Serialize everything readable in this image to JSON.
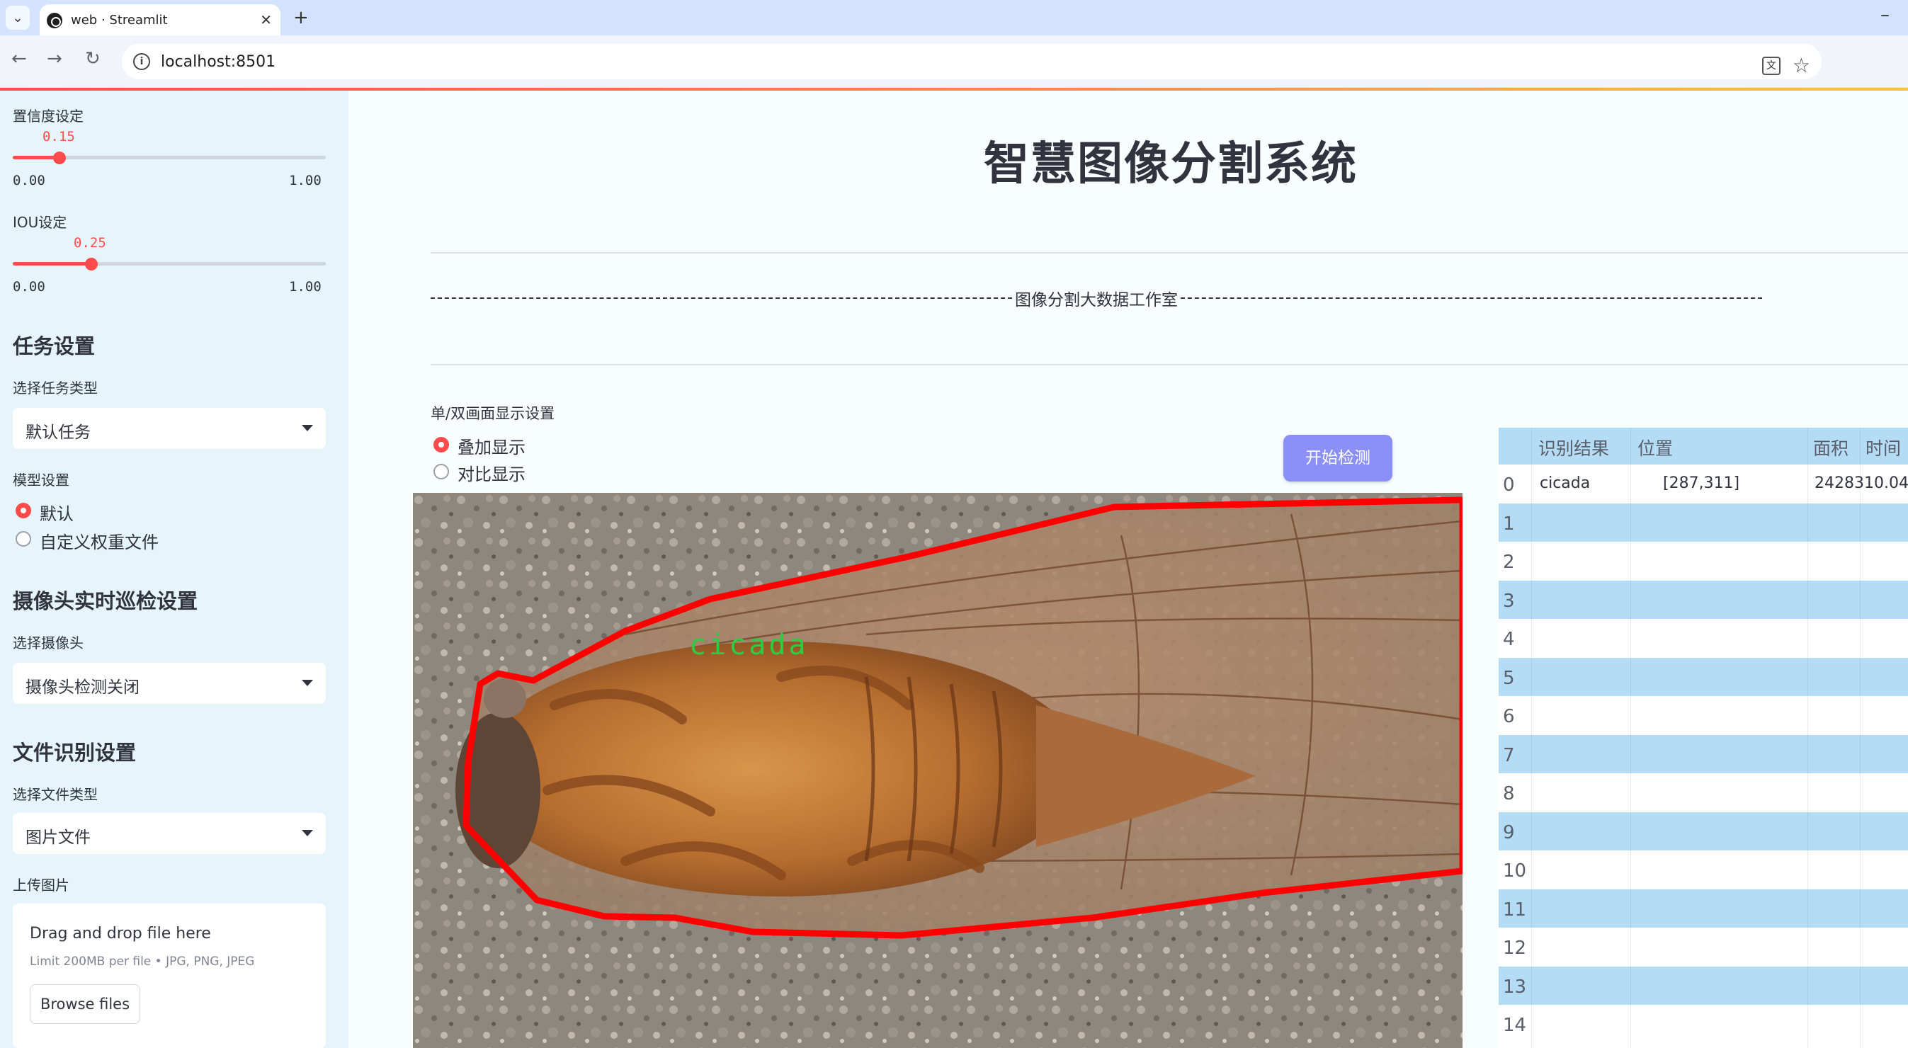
{
  "browser": {
    "tab_title": "web · Streamlit",
    "url": "localhost:8501"
  },
  "sidebar": {
    "confidence": {
      "label": "置信度设定",
      "value": "0.15",
      "min": "0.00",
      "max": "1.00",
      "fraction": 0.15
    },
    "iou": {
      "label": "IOU设定",
      "value": "0.25",
      "min": "0.00",
      "max": "1.00",
      "fraction": 0.25
    },
    "task_header": "任务设置",
    "task_type_label": "选择任务类型",
    "task_type_value": "默认任务",
    "model_label": "模型设置",
    "model_options": [
      "默认",
      "自定义权重文件"
    ],
    "camera_header": "摄像头实时巡检设置",
    "camera_label": "选择摄像头",
    "camera_value": "摄像头检测关闭",
    "file_header": "文件识别设置",
    "file_type_label": "选择文件类型",
    "file_type_value": "图片文件",
    "upload_label": "上传图片",
    "upload_title": "Drag and drop file here",
    "upload_limit": "Limit 200MB per file • JPG, PNG, JPEG",
    "browse_label": "Browse files"
  },
  "main": {
    "title": "智慧图像分割系统",
    "divider_text": "图像分割大数据工作室",
    "display_label": "单/双画面显示设置",
    "display_options": [
      "叠加显示",
      "对比显示"
    ],
    "detect_button": "开始检测",
    "detection_label": "cicada"
  },
  "results": {
    "columns": [
      "识别结果",
      "位置",
      "面积",
      "时间"
    ],
    "rows": [
      {
        "index": "0",
        "result": "cicada",
        "position": "[287,311]",
        "area": "2428310.04"
      },
      {
        "index": "1"
      },
      {
        "index": "2"
      },
      {
        "index": "3"
      },
      {
        "index": "4"
      },
      {
        "index": "5"
      },
      {
        "index": "6"
      },
      {
        "index": "7"
      },
      {
        "index": "8"
      },
      {
        "index": "9"
      },
      {
        "index": "10"
      },
      {
        "index": "11"
      },
      {
        "index": "12"
      },
      {
        "index": "13"
      },
      {
        "index": "14"
      }
    ]
  },
  "colors": {
    "accent": "#ff4b4b",
    "button": "#8b8ff8",
    "sidebar_bg": "#e6f5fc",
    "table_stripe": "#b4dcf5",
    "mask_outline": "#ff0000",
    "label_text": "#2ecc40"
  }
}
